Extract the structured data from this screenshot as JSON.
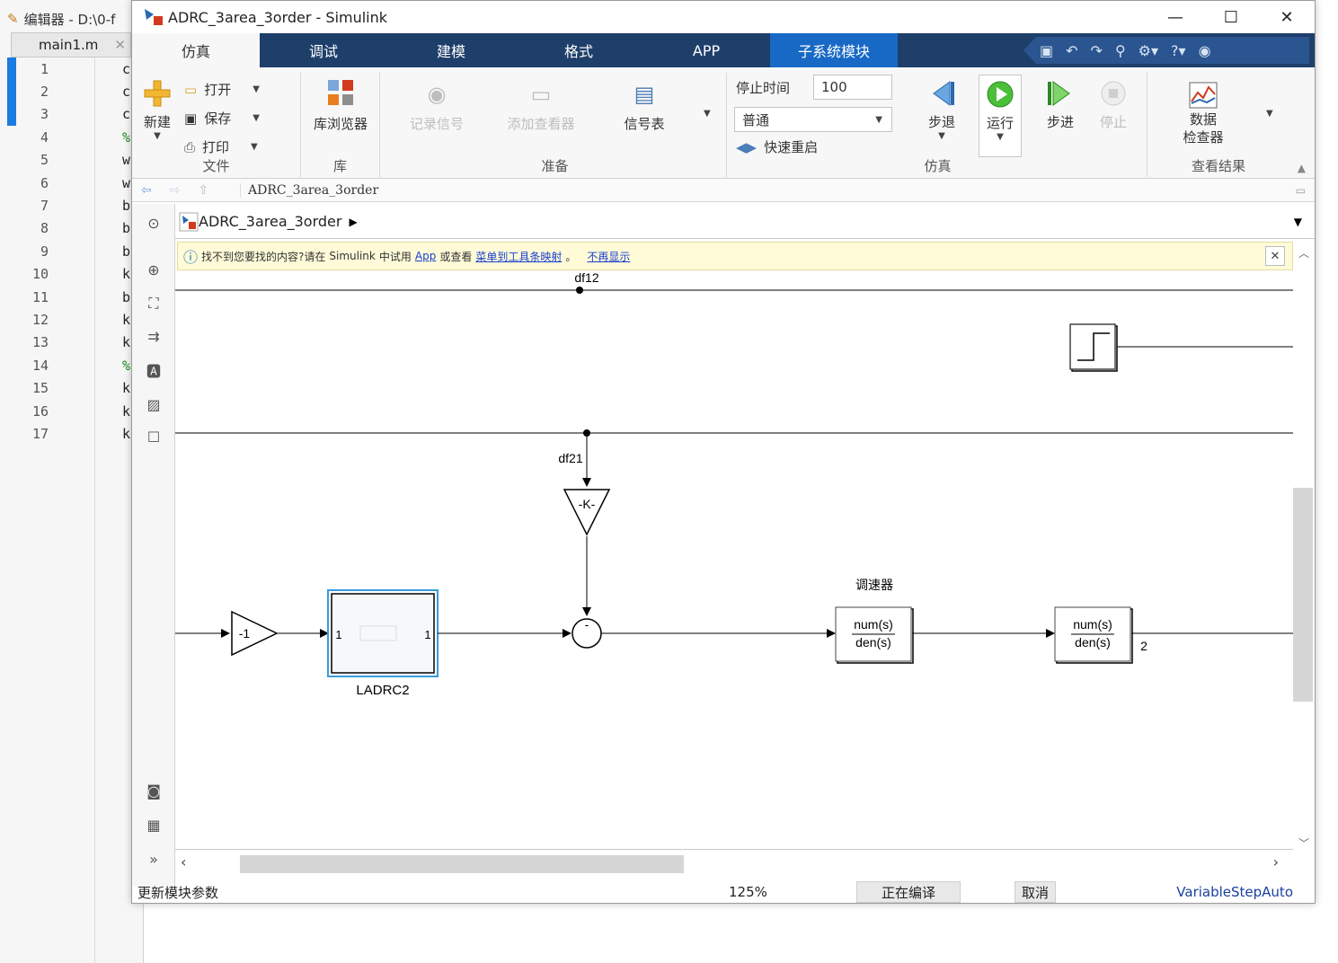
{
  "editor": {
    "title": "编辑器 - D:\\0-f",
    "tab_label": "main1.m",
    "lines": [
      {
        "num": "1",
        "code": "c"
      },
      {
        "num": "2",
        "code": "c"
      },
      {
        "num": "3",
        "code": "c"
      },
      {
        "num": "4",
        "code": "%"
      },
      {
        "num": "5",
        "code": "w"
      },
      {
        "num": "6",
        "code": "w"
      },
      {
        "num": "7",
        "code": "b"
      },
      {
        "num": "8",
        "code": "b"
      },
      {
        "num": "9",
        "code": "b"
      },
      {
        "num": "10",
        "code": "k"
      },
      {
        "num": "11",
        "code": "b"
      },
      {
        "num": "12",
        "code": "k"
      },
      {
        "num": "13",
        "code": "k"
      },
      {
        "num": "14",
        "code": "%"
      },
      {
        "num": "15",
        "code": "k"
      },
      {
        "num": "16",
        "code": "k"
      },
      {
        "num": "17",
        "code": "k"
      }
    ]
  },
  "window": {
    "title": "ADRC_3area_3order - Simulink"
  },
  "tabs": [
    {
      "label": "仿真"
    },
    {
      "label": "调试"
    },
    {
      "label": "建模"
    },
    {
      "label": "格式"
    },
    {
      "label": "APP"
    },
    {
      "label": "子系统模块"
    }
  ],
  "ribbon": {
    "file": {
      "new": "新建",
      "open": "打开",
      "save": "保存",
      "print": "打印",
      "group": "文件"
    },
    "library": {
      "browser": "库浏览器",
      "group": "库"
    },
    "prepare": {
      "log_signals": "记录信号",
      "add_viewer": "添加查看器",
      "signal_table": "信号表",
      "group": "准备"
    },
    "simulate": {
      "stop_time_label": "停止时间",
      "stop_time_value": "100",
      "mode": "普通",
      "fast_restart": "快速重启",
      "step_back": "步退",
      "run": "运行",
      "step_forward": "步进",
      "stop": "停止",
      "group": "仿真"
    },
    "review": {
      "data_inspector_1": "数据",
      "data_inspector_2": "检查器",
      "group": "查看结果"
    }
  },
  "address": {
    "path": "ADRC_3area_3order"
  },
  "model_path": "ADRC_3area_3order",
  "info_bar": {
    "text1": "找不到您要找的内容?请在",
    "simulink": "Simulink",
    "text2": "中试用",
    "app_link": "App",
    "text3": "或查看",
    "menu_link": "菜单到工具条映射",
    "text4": "。",
    "dismiss_link": "不再显示"
  },
  "diagram": {
    "signal_top": "df12",
    "signal_mid": "df21",
    "gain_k": "-K-",
    "gain_neg1": "-1",
    "subsystem_name": "LADRC2",
    "subsystem_in_port": "1",
    "subsystem_out_port": "1",
    "sum_sign": "-",
    "governor_label": "调速器",
    "tf1_num": "num(s)",
    "tf1_den": "den(s)",
    "tf2_num": "num(s)",
    "tf2_den": "den(s)",
    "port_out": "2"
  },
  "status": {
    "left": "更新模块参数",
    "zoom": "125%",
    "progress": "正在编译",
    "cancel": "取消",
    "solver": "VariableStepAuto"
  }
}
